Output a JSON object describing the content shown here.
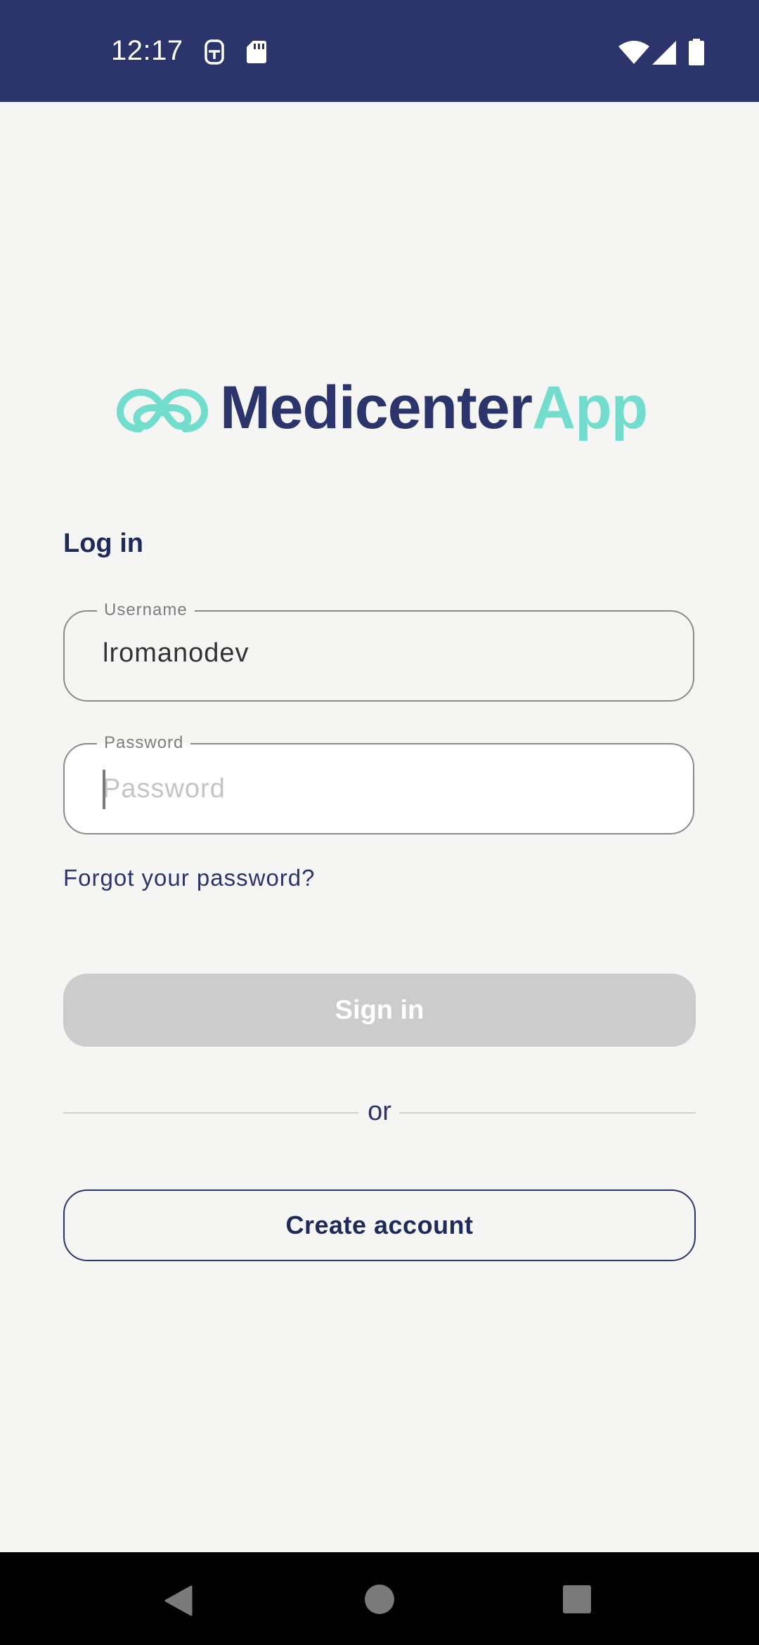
{
  "status_bar": {
    "time": "12:17",
    "icons_left": [
      "sim-card-toolkit-icon",
      "sd-card-icon"
    ],
    "icons_right": [
      "wifi-icon",
      "signal-icon",
      "battery-icon"
    ],
    "background": "#2b356b"
  },
  "brand": {
    "name_part1": "Medicenter",
    "name_part2": "App",
    "color_primary": "#2b356b",
    "color_accent": "#72dccd"
  },
  "login": {
    "heading": "Log in",
    "username": {
      "label": "Username",
      "value": "lromanodev"
    },
    "password": {
      "label": "Password",
      "placeholder": "Password",
      "value": ""
    },
    "forgot_link": "Forgot your password?",
    "signin_label": "Sign in",
    "signin_enabled": false,
    "divider_text": "or",
    "create_account_label": "Create account"
  },
  "nav_bar": {
    "buttons": [
      "back-icon",
      "home-icon",
      "recents-icon"
    ]
  }
}
